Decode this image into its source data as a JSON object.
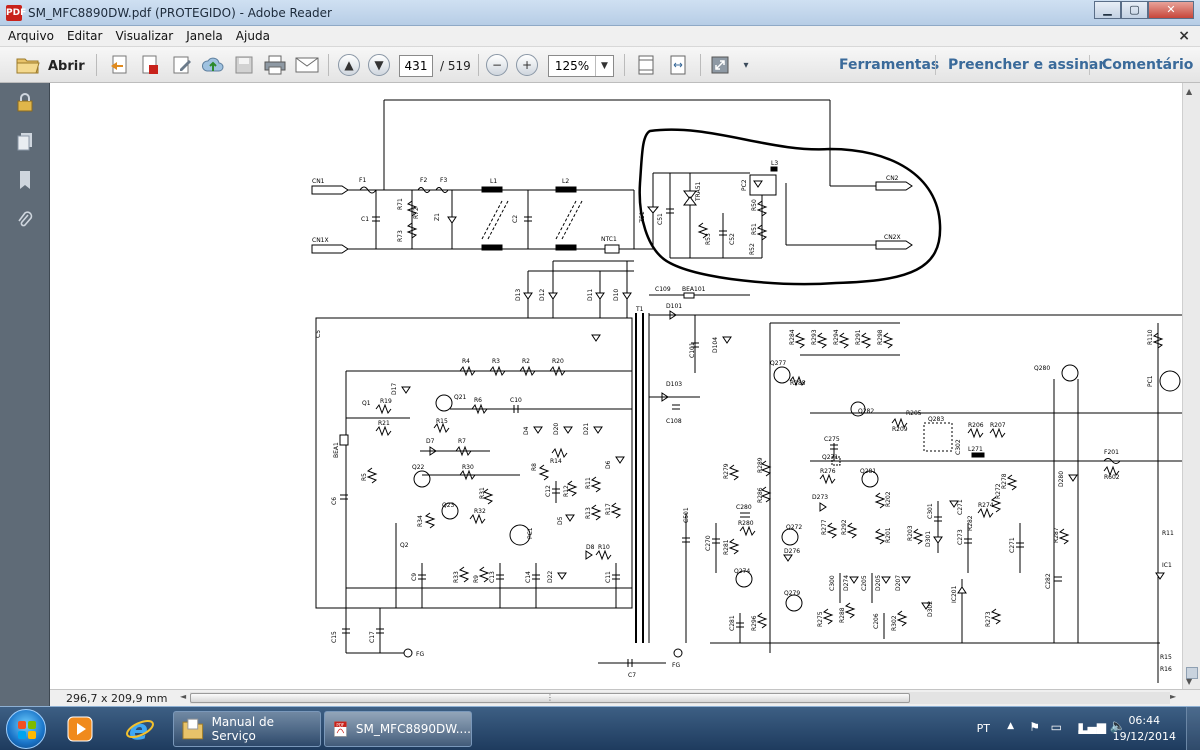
{
  "window": {
    "title": "SM_MFC8890DW.pdf (PROTEGIDO) - Adobe Reader",
    "app_icon_text": "PDF"
  },
  "menu": {
    "items": [
      "Arquivo",
      "Editar",
      "Visualizar",
      "Janela",
      "Ajuda"
    ],
    "close_glyph": "×"
  },
  "toolbar": {
    "open_label": "Abrir",
    "page_current": "431",
    "page_total": "/ 519",
    "zoom": "125%",
    "right_links": [
      "Ferramentas",
      "Preencher e assinar",
      "Comentário"
    ]
  },
  "status": {
    "dimensions": "296,7 x 209,9 mm"
  },
  "schematic": {
    "labels": {
      "cn1": "CN1",
      "cn1x": "CN1X",
      "cn2": "CN2",
      "cn2x": "CN2X",
      "f1": "F1",
      "f2": "F2",
      "f3": "F3",
      "l1": "L1",
      "l2": "L2",
      "l3": "L3",
      "c1": "C1",
      "c2": "C2",
      "r71": "R71",
      "r72": "R72",
      "r73": "R73",
      "z1": "Z1",
      "ntc1": "NTC1",
      "tra51": "TRA51",
      "pc2": "PC2",
      "c51": "C51",
      "c52": "C52",
      "r53": "R53",
      "r50": "R50",
      "r51": "R51",
      "r52": "R52",
      "z51": "Z51",
      "d13": "D13",
      "d12": "D12",
      "d11": "D11",
      "d10": "D10",
      "c109": "C109",
      "bea101": "BEA101",
      "d101": "D101",
      "t1": "T1",
      "c101": "C101",
      "d104": "D104",
      "d103": "D103",
      "c108": "C108",
      "r4": "R4",
      "r3": "R3",
      "r2": "R2",
      "r20": "R20",
      "q1": "Q1",
      "r19": "R19",
      "d17": "D17",
      "q21": "Q21",
      "r6": "R6",
      "c10": "C10",
      "r15": "R15",
      "r21": "R21",
      "d7": "D7",
      "r7": "R7",
      "d4": "D4",
      "d20": "D20",
      "d21": "D21",
      "bea1": "BEA1",
      "r5": "R5",
      "q22": "Q22",
      "r30": "R30",
      "r8": "R8",
      "r14": "R14",
      "d6": "D6",
      "c12": "C12",
      "r12": "R12",
      "r11": "R11",
      "r17": "R17",
      "r31": "R31",
      "q23": "Q23",
      "r34": "R34",
      "r32": "R32",
      "pc1": "PC1",
      "d5": "D5",
      "r13": "R13",
      "q2": "Q2",
      "c9": "C9",
      "r33": "R33",
      "r9": "R9",
      "c13": "C13",
      "c14": "C14",
      "d22": "D22",
      "d8": "D8",
      "r10": "R10",
      "c11": "C11",
      "c15": "C15",
      "c17": "C17",
      "c6": "C6",
      "c5": "C5",
      "c7": "C7",
      "fg": "FG",
      "r284": "R284",
      "r293": "R293",
      "r294": "R294",
      "r291": "R291",
      "r298": "R298",
      "q277": "Q277",
      "r285": "R285",
      "q282": "Q282",
      "r205": "R205",
      "r209": "R209",
      "q283": "Q283",
      "r206": "R206",
      "r207": "R207",
      "c302": "C302",
      "l271": "L271",
      "c275": "C275",
      "q271": "Q271",
      "r276": "R276",
      "d273": "D273",
      "q281": "Q281",
      "r202": "R202",
      "r201": "R201",
      "r203": "R203",
      "c301": "C301",
      "c271": "C271",
      "d301": "D301",
      "r274": "R274",
      "r272": "R272",
      "r278": "R278",
      "c273": "C273",
      "r282": "R282",
      "c501": "C501",
      "r279": "R279",
      "r289": "R289",
      "r286": "R286",
      "c280": "C280",
      "r280": "R280",
      "q272": "Q272",
      "r277": "R277",
      "r292": "R292",
      "c270": "C270",
      "r281": "R281",
      "d276": "D276",
      "q274": "Q274",
      "q279": "Q279",
      "c281": "C281",
      "r296": "R296",
      "r275": "R275",
      "c300": "C300",
      "d274": "D274",
      "r288": "R288",
      "c205": "C205",
      "d205": "D205",
      "d207": "D207",
      "c206": "C206",
      "r302": "R302",
      "d302": "D302",
      "ic201": "IC201",
      "r273": "R273",
      "q280": "Q280",
      "d280": "D280",
      "r287": "R287",
      "c282": "C282",
      "f201": "F201",
      "r602": "R602",
      "r110": "R110",
      "pc1b": "PC1",
      "r111": "R11",
      "ic1": "IC1",
      "r15b": "R15",
      "r16": "R16"
    }
  },
  "taskbar": {
    "items": [
      "Manual de Serviço",
      "SM_MFC8890DW...."
    ],
    "lang": "PT",
    "time": "06:44",
    "date": "19/12/2014"
  },
  "colors": {
    "accent": "#3a6a9a",
    "annotation": "#000000"
  }
}
